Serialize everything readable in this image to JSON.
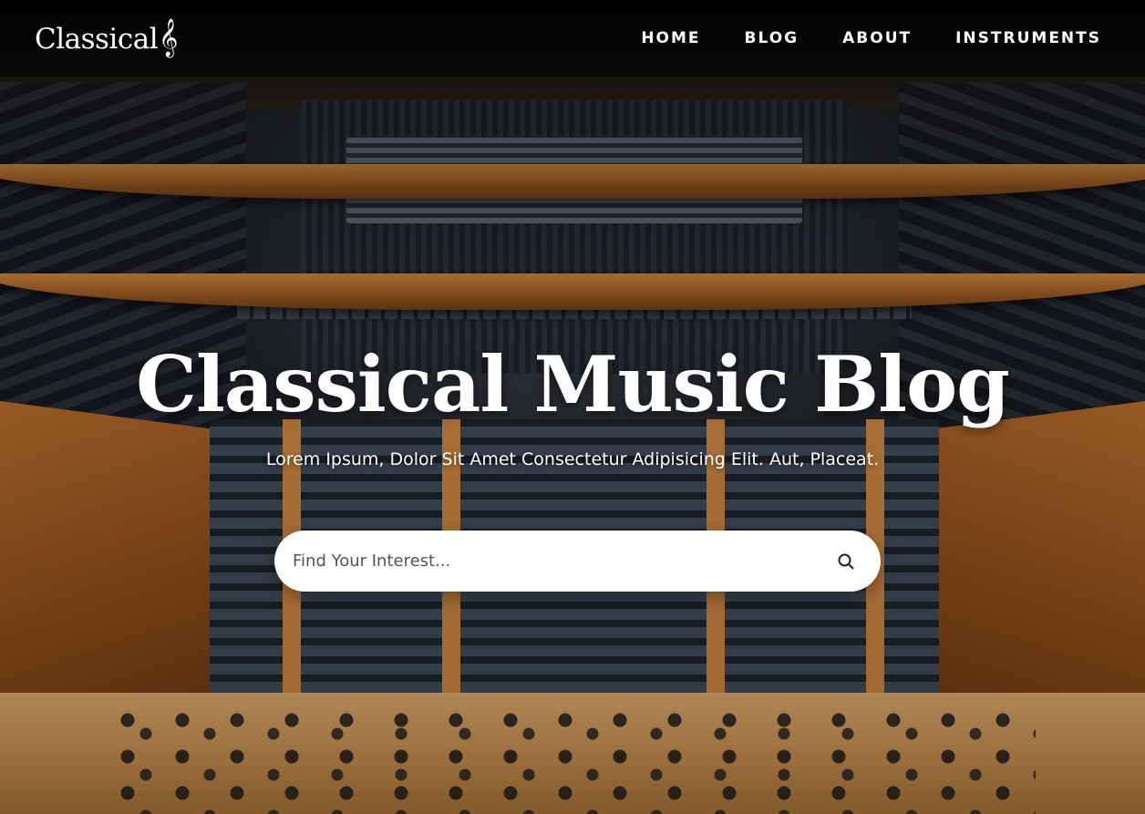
{
  "site": {
    "logo_text": "Classical",
    "logo_glyph": "𝄞"
  },
  "nav": {
    "items": [
      {
        "label": "HOME"
      },
      {
        "label": "BLOG"
      },
      {
        "label": "ABOUT"
      },
      {
        "label": "INSTRUMENTS"
      }
    ]
  },
  "hero": {
    "title": "Classical Music Blog",
    "subtitle": "Lorem Ipsum, Dolor Sit Amet Consectetur Adipisicing Elit. Aut, Placeat.",
    "background": "concert hall with orchestra stage"
  },
  "search": {
    "placeholder": "Find Your Interest...",
    "value": "",
    "icon": "search-icon"
  },
  "colors": {
    "header_bg": "#000000",
    "text": "#ffffff",
    "search_bg": "#ffffff"
  }
}
